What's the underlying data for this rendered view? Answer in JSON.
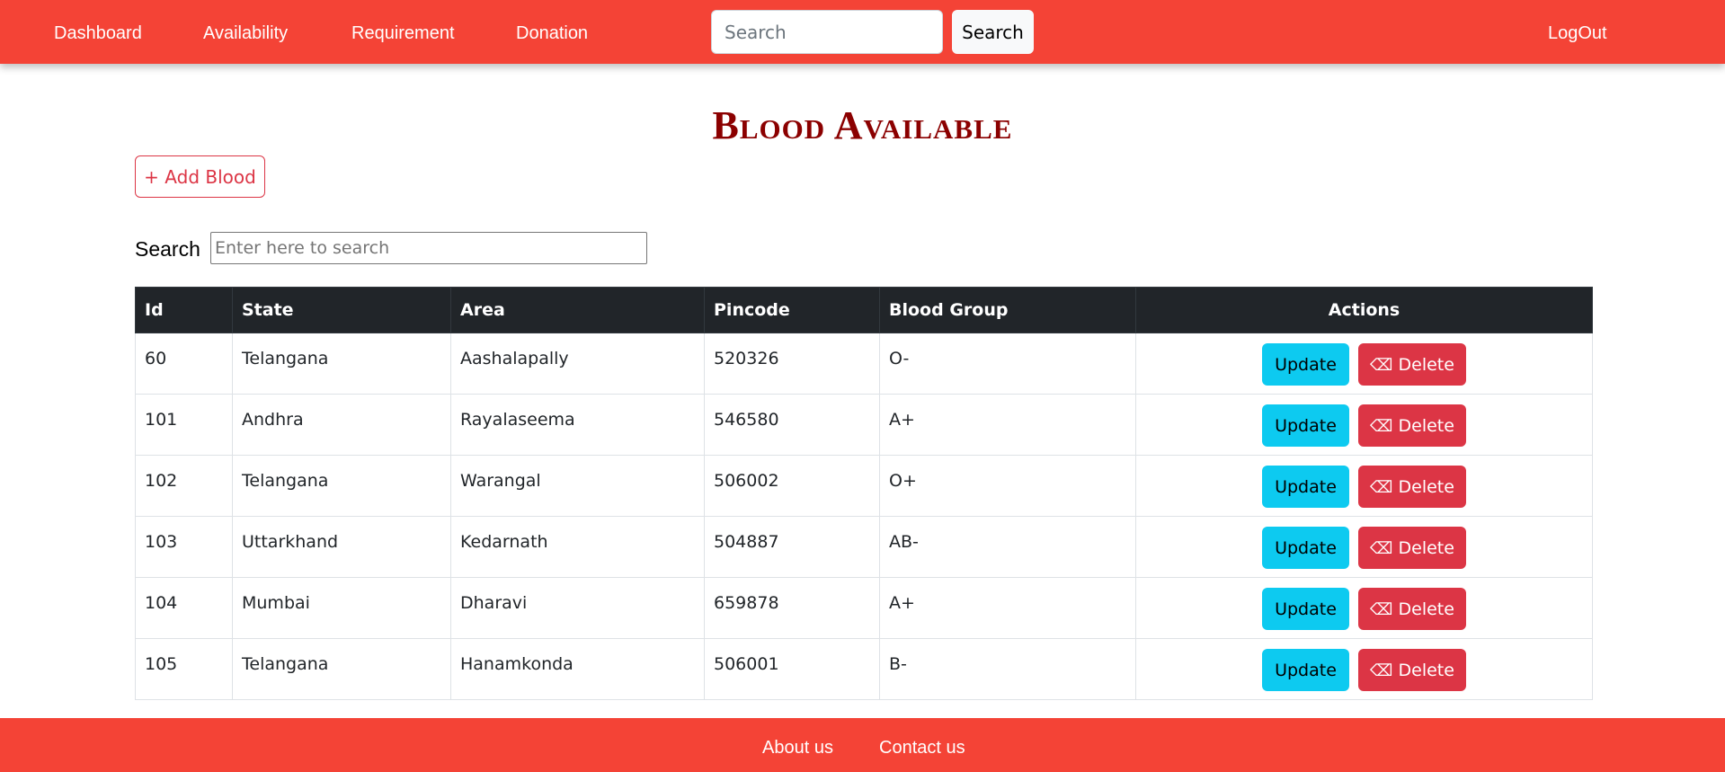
{
  "nav": {
    "links": [
      "Dashboard",
      "Availability",
      "Requirement",
      "Donation"
    ],
    "search_placeholder": "Search",
    "search_button": "Search",
    "logout": "LogOut"
  },
  "page": {
    "title": "Blood Available",
    "add_button": "+ Add Blood",
    "filter_label": "Search",
    "filter_placeholder": "Enter here to search"
  },
  "table": {
    "headers": [
      "Id",
      "State",
      "Area",
      "Pincode",
      "Blood Group",
      "Actions"
    ],
    "rows": [
      [
        "60",
        "Telangana",
        "Aashalapally",
        "520326",
        "O-"
      ],
      [
        "101",
        "Andhra",
        "Rayalaseema",
        "546580",
        "A+"
      ],
      [
        "102",
        "Telangana",
        "Warangal",
        "506002",
        "O+"
      ],
      [
        "103",
        "Uttarkhand",
        "Kedarnath",
        "504887",
        "AB-"
      ],
      [
        "104",
        "Mumbai",
        "Dharavi",
        "659878",
        "A+"
      ],
      [
        "105",
        "Telangana",
        "Hanamkonda",
        "506001",
        "B-"
      ]
    ],
    "update_label": "Update",
    "delete_label": "Delete",
    "delete_icon": "eraser-icon"
  },
  "footer": {
    "links": [
      "About us",
      "Contact us"
    ]
  },
  "colors": {
    "navbar": "#f44336",
    "title": "#8b0000",
    "table_header": "#212529",
    "update_button": "#0dcaf0",
    "delete_button": "#dc3545"
  }
}
